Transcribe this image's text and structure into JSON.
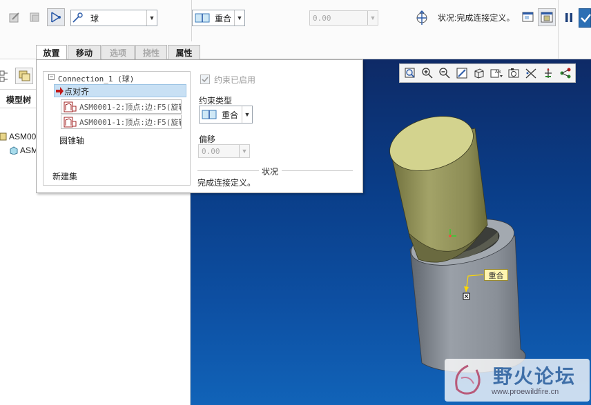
{
  "dashboard": {
    "connection_type": "球",
    "constraint_type": "重合",
    "offset_value": "0.00",
    "status_text": "状况:完成连接定义。"
  },
  "tabs": [
    {
      "label": "放置",
      "state": "active"
    },
    {
      "label": "移动",
      "state": "enabled"
    },
    {
      "label": "选项",
      "state": "disabled"
    },
    {
      "label": "挠性",
      "state": "disabled"
    },
    {
      "label": "属性",
      "state": "enabled"
    }
  ],
  "tree": {
    "title": "模型树",
    "root": "ASM00",
    "child": "ASM"
  },
  "panel": {
    "connection_name": "Connection_1 (球)",
    "selected_constraint": "点对齐",
    "refs": [
      "ASM0001-2:顶点:边:F5(旋转",
      "ASM0001-1:顶点:边:F5(旋转"
    ],
    "next_item": "圆锥轴",
    "new_set": "新建集",
    "enabled_label": "约束已启用",
    "type_label": "约束类型",
    "type_value": "重合",
    "offset_label": "偏移",
    "offset_value": "0.00",
    "status_label": "状况",
    "status_text": "完成连接定义。"
  },
  "viewport": {
    "callout": "重合"
  },
  "watermark": {
    "title": "野火论坛",
    "url": "www.proewildfire.cn"
  },
  "colors": {
    "accent_blue": "#2a6fc9",
    "selection_blue": "#c8e0f4",
    "arrow_red": "#c01818",
    "callout_bg": "#fff5b0",
    "part_top": "#cfcf8a",
    "part_gray": "#8b919a"
  }
}
